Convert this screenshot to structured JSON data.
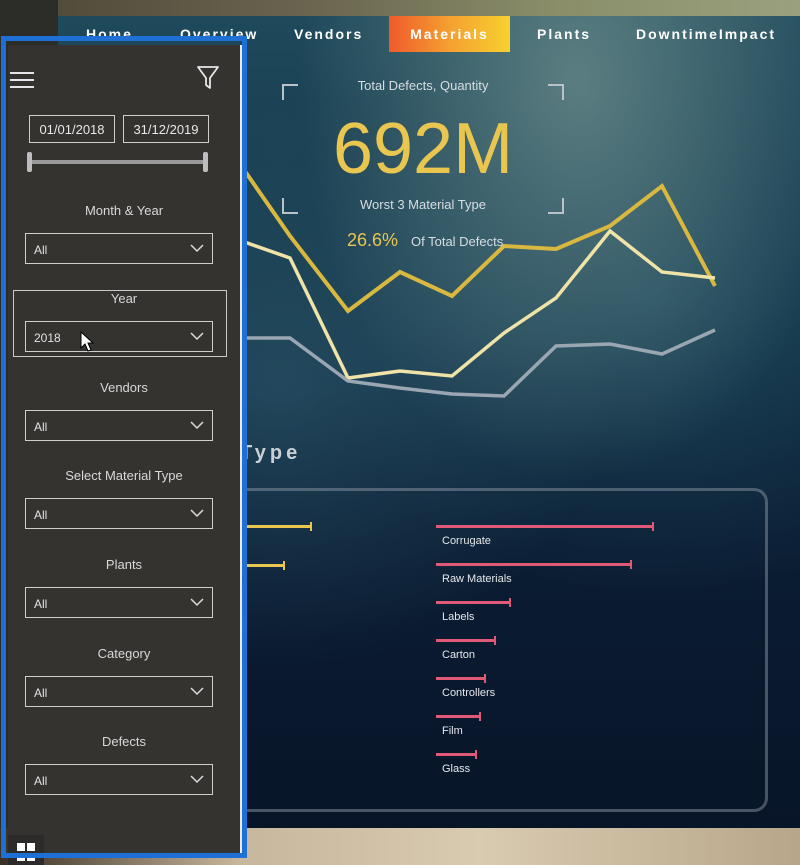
{
  "nav": {
    "tabs": [
      {
        "label": "Home"
      },
      {
        "label": "Overview"
      },
      {
        "label": "Vendors"
      },
      {
        "label": "Materials",
        "active": true
      },
      {
        "label": "Plants"
      },
      {
        "label": "DowntimeImpact"
      }
    ]
  },
  "kpi": {
    "title": "Total Defects, Quantity",
    "value": "692M",
    "subtitle": "Worst 3 Material Type",
    "percent": "26.6%",
    "percent_label": "Of Total Defects"
  },
  "section": {
    "title_fragment": "Type"
  },
  "material_bars": [
    {
      "label": "Corrugate",
      "value": 1.0
    },
    {
      "label": "Raw Materials",
      "value": 0.9
    },
    {
      "label": "Labels",
      "value": 0.34
    },
    {
      "label": "Carton",
      "value": 0.27
    },
    {
      "label": "Controllers",
      "value": 0.22
    },
    {
      "label": "Film",
      "value": 0.2
    },
    {
      "label": "Glass",
      "value": 0.18
    }
  ],
  "left_bars": [
    {
      "value": 1.0
    },
    {
      "value": 0.67
    }
  ],
  "slicers": {
    "date_start": "01/01/2018",
    "date_end": "31/12/2019",
    "month_year": {
      "label": "Month & Year",
      "value": "All"
    },
    "year": {
      "label": "Year",
      "value": "2018"
    },
    "vendors": {
      "label": "Vendors",
      "value": "All"
    },
    "material_type": {
      "label": "Select Material Type",
      "value": "All"
    },
    "plants": {
      "label": "Plants",
      "value": "All"
    },
    "category": {
      "label": "Category",
      "value": "All"
    },
    "defects": {
      "label": "Defects",
      "value": "All"
    }
  },
  "colors": {
    "accent_yellow": "#e8c650",
    "bar_pink": "#e05a78",
    "selection_outline": "#1e6fd6",
    "pane_bg": "#353330"
  },
  "icons": {
    "menu": "hamburger-icon",
    "filter": "funnel-icon",
    "chevron": "chevron-down-icon",
    "windows": "windows-start-icon",
    "cursor": "mouse-pointer-icon"
  }
}
